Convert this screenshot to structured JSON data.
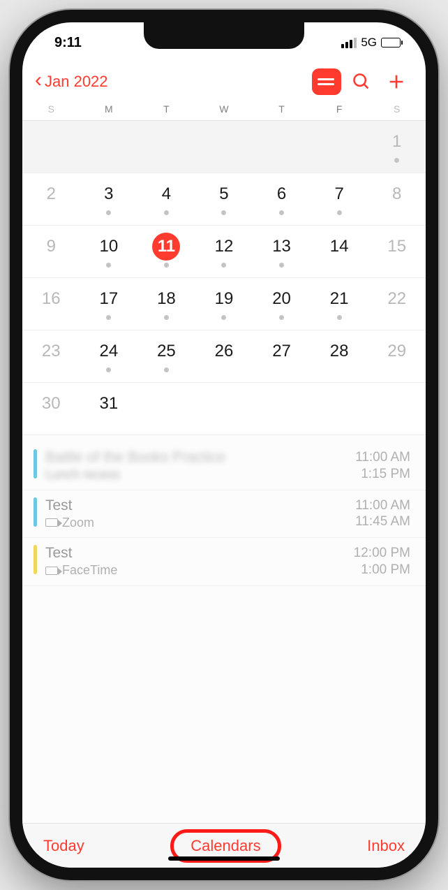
{
  "status": {
    "time": "9:11",
    "network": "5G"
  },
  "nav": {
    "back_label": "Jan 2022"
  },
  "dow": [
    "S",
    "M",
    "T",
    "W",
    "T",
    "F",
    "S"
  ],
  "calendar": {
    "today": 11,
    "weeks": [
      [
        {
          "n": "",
          "empty": true
        },
        {
          "n": "",
          "empty": true
        },
        {
          "n": "",
          "empty": true
        },
        {
          "n": "",
          "empty": true
        },
        {
          "n": "",
          "empty": true
        },
        {
          "n": "",
          "empty": true
        },
        {
          "n": 1,
          "wknd": true,
          "dot": true
        }
      ],
      [
        {
          "n": 2,
          "wknd": true
        },
        {
          "n": 3,
          "dot": true
        },
        {
          "n": 4,
          "dot": true
        },
        {
          "n": 5,
          "dot": true
        },
        {
          "n": 6,
          "dot": true
        },
        {
          "n": 7,
          "dot": true
        },
        {
          "n": 8,
          "wknd": true
        }
      ],
      [
        {
          "n": 9,
          "wknd": true
        },
        {
          "n": 10,
          "dot": true
        },
        {
          "n": 11,
          "dot": true,
          "today": true
        },
        {
          "n": 12,
          "dot": true
        },
        {
          "n": 13,
          "dot": true
        },
        {
          "n": 14
        },
        {
          "n": 15,
          "wknd": true
        }
      ],
      [
        {
          "n": 16,
          "wknd": true
        },
        {
          "n": 17,
          "dot": true
        },
        {
          "n": 18,
          "dot": true
        },
        {
          "n": 19,
          "dot": true
        },
        {
          "n": 20,
          "dot": true
        },
        {
          "n": 21,
          "dot": true
        },
        {
          "n": 22,
          "wknd": true
        }
      ],
      [
        {
          "n": 23,
          "wknd": true
        },
        {
          "n": 24,
          "dot": true
        },
        {
          "n": 25,
          "dot": true
        },
        {
          "n": 26
        },
        {
          "n": 27
        },
        {
          "n": 28
        },
        {
          "n": 29,
          "wknd": true
        }
      ],
      [
        {
          "n": 30,
          "wknd": true
        },
        {
          "n": 31
        },
        {
          "n": "",
          "empty": true
        },
        {
          "n": "",
          "empty": true
        },
        {
          "n": "",
          "empty": true
        },
        {
          "n": "",
          "empty": true
        },
        {
          "n": "",
          "empty": true
        }
      ]
    ]
  },
  "events": [
    {
      "color": "#6ec8e0",
      "title": "Battle of the Books Practice",
      "sub": "Lunch recess",
      "start": "11:00 AM",
      "end": "1:15 PM",
      "blur": true,
      "video": false
    },
    {
      "color": "#6ec8e0",
      "title": "Test",
      "sub": "Zoom",
      "start": "11:00 AM",
      "end": "11:45 AM",
      "video": true
    },
    {
      "color": "#f1d65c",
      "title": "Test",
      "sub": "FaceTime",
      "start": "12:00 PM",
      "end": "1:00 PM",
      "video": true
    }
  ],
  "toolbar": {
    "today": "Today",
    "calendars": "Calendars",
    "inbox": "Inbox"
  }
}
